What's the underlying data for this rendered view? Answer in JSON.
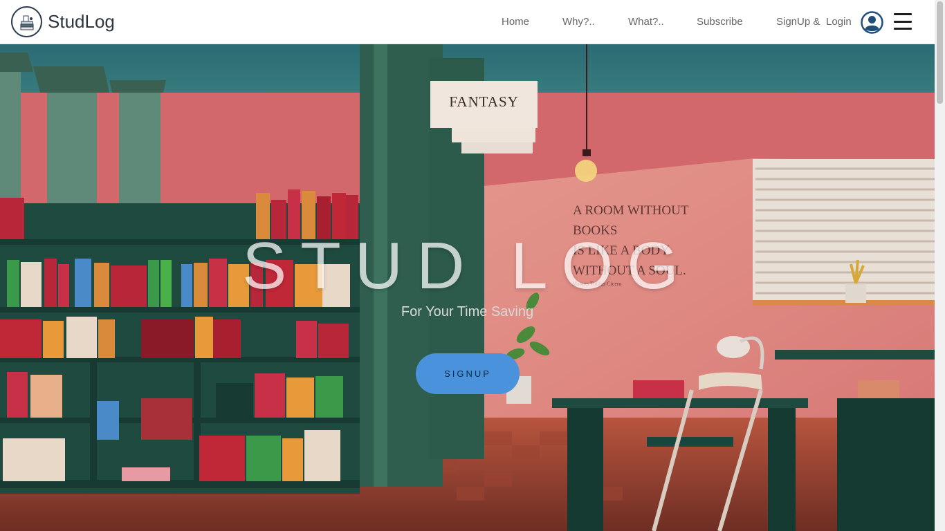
{
  "brand": {
    "name": "StudLog",
    "logo_icon": "books-stack-icon"
  },
  "nav": {
    "home": "Home",
    "why": "Why?..",
    "what": "What?..",
    "subscribe": "Subscribe",
    "signup": "SignUp &",
    "login": "Login",
    "user_icon": "user-circle-icon",
    "menu_icon": "hamburger-menu-icon"
  },
  "hero": {
    "title": "STUD LOG",
    "subtitle": "For Your Time Saving",
    "signup_button": "SIGNUP",
    "sign": "FANTASY",
    "quote_lines": [
      "A ROOM WITHOUT",
      "BOOKS",
      "IS LIKE A BODY",
      "WITHOUT A SOUL."
    ],
    "quote_author": "Marcus Tullius Cicero"
  },
  "colors": {
    "accent": "#4a93dc",
    "navbar_bg": "#ffffff",
    "nav_text": "#666666"
  }
}
